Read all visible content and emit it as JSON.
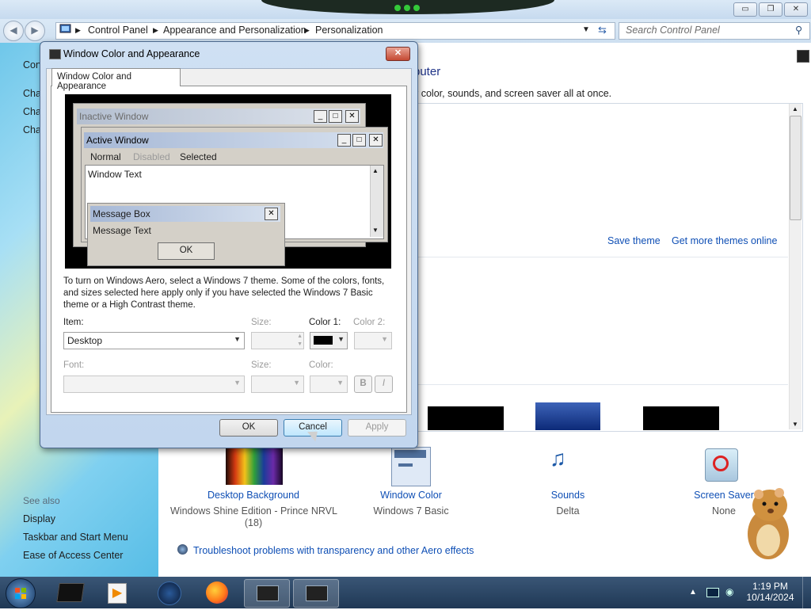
{
  "explorer": {
    "window_controls": {
      "minimize": "▭",
      "maximize": "❐",
      "close": "✕"
    },
    "breadcrumb": [
      "Control Panel",
      "Appearance and Personalization",
      "Personalization"
    ],
    "search_placeholder": "Search Control Panel",
    "left_pane": {
      "top_items": [
        "Con",
        "Cha",
        "Cha",
        "Cha"
      ],
      "see_also_label": "See also",
      "see_also_links": [
        "Display",
        "Taskbar and Start Menu",
        "Ease of Access Center"
      ]
    },
    "heading_fragment": "puter",
    "subheading_fragment": "v color, sounds, and screen saver all at once.",
    "theme_links": {
      "save": "Save theme",
      "get_more": "Get more themes online"
    },
    "bottom_items": [
      {
        "title": "Desktop Background",
        "subtitle": "Windows Shine Edition - Prince NRVL",
        "extra": "(18)"
      },
      {
        "title": "Window Color",
        "subtitle": "Windows 7 Basic"
      },
      {
        "title": "Sounds",
        "subtitle": "Delta"
      },
      {
        "title": "Screen Saver",
        "subtitle": "None"
      }
    ],
    "troubleshoot_link": "Troubleshoot problems with transparency and other Aero effects"
  },
  "dialog": {
    "title": "Window Color and Appearance",
    "tab_label": "Window Color and Appearance",
    "preview": {
      "inactive_title": "Inactive Window",
      "active_title": "Active Window",
      "menu": {
        "normal": "Normal",
        "disabled": "Disabled",
        "selected": "Selected"
      },
      "window_text": "Window Text",
      "message_box_title": "Message Box",
      "message_text": "Message Text",
      "ok": "OK"
    },
    "info_text": "To turn on Windows Aero, select a Windows 7 theme.  Some of the colors, fonts, and sizes selected here apply only if you have selected the Windows 7 Basic theme or a High Contrast theme.",
    "labels": {
      "item": "Item:",
      "size": "Size:",
      "color1": "Color 1:",
      "color2": "Color 2:",
      "font": "Font:",
      "font_size": "Size:",
      "font_color": "Color:"
    },
    "item_value": "Desktop",
    "color1_value": "#000000",
    "bold_label": "B",
    "italic_label": "I",
    "buttons": {
      "ok": "OK",
      "cancel": "Cancel",
      "apply": "Apply"
    }
  },
  "taskbar": {
    "time": "1:19 PM",
    "date": "10/14/2024"
  }
}
